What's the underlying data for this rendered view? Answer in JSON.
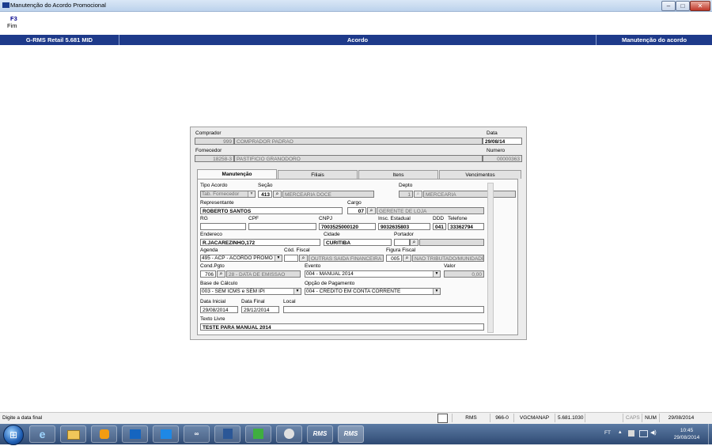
{
  "window": {
    "title": "Manutenção do Acordo Promocional",
    "minimize": "–",
    "maximize": "□",
    "close": "✕"
  },
  "menu": {
    "key": "F3",
    "label": "Fim"
  },
  "header": {
    "app": "G-RMS Retail 5.681 MID",
    "center": "Acordo",
    "right": "Manutenção do acordo"
  },
  "form": {
    "comprador": {
      "label": "Comprador",
      "code": "999",
      "name": "COMPRADOR PADRAO"
    },
    "data": {
      "label": "Data",
      "value": "29/08/14"
    },
    "fornecedor": {
      "label": "Fornecedor",
      "code": "18258-3",
      "name": "PASTIFICIO GRANODORO"
    },
    "numero": {
      "label": "Numero",
      "value": "00000363"
    },
    "tabs": [
      "Manutenção",
      "Filiais",
      "Itens",
      "Vencimentos"
    ],
    "tipo_acordo": {
      "label": "Tipo Acordo",
      "value": "Tab. Fornecedor"
    },
    "secao": {
      "label": "Seção",
      "code": "413",
      "name": "MERCEARIA DOCE"
    },
    "depto": {
      "label": "Depto",
      "code": "1",
      "name": "MERCEARIA"
    },
    "representante": {
      "label": "Representante",
      "value": "ROBERTO SANTOS"
    },
    "cargo": {
      "label": "Cargo",
      "code": "07",
      "name": "GERENTE DE LOJA"
    },
    "rg": {
      "label": "RG",
      "value": ""
    },
    "cpf": {
      "label": "CPF",
      "value": ""
    },
    "cnpj": {
      "label": "CNPJ",
      "value": "7003525000120"
    },
    "insc": {
      "label": "Insc. Estadual",
      "value": "9032635803"
    },
    "ddd": {
      "label": "DDD",
      "value": "041"
    },
    "telefone": {
      "label": "Telefone",
      "value": "33362794"
    },
    "endereco": {
      "label": "Endereco",
      "value": "R.JACAREZINHO,172"
    },
    "cidade": {
      "label": "Cidade",
      "value": "CURITIBA"
    },
    "portador": {
      "label": "Portador",
      "value": ""
    },
    "agenda": {
      "label": "Agenda",
      "value": "495 - ACP - ACORDO PROMO"
    },
    "cod_fiscal": {
      "label": "Cód. Fiscal",
      "code": "",
      "name": "OUTRAS SAIDA FINANCEIRA"
    },
    "figura_fiscal": {
      "label": "Figura Fiscal",
      "code": "005",
      "name": "NAO TRIBUTADO/MUNIDADE"
    },
    "cond_pgto": {
      "label": "Cond.Pgto",
      "code": "706",
      "name": "28 - DATA DE EMISSAO"
    },
    "evento": {
      "label": "Evento",
      "value": "004 - MANUAL 2014"
    },
    "valor": {
      "label": "Valor",
      "value": "0,00"
    },
    "base_calculo": {
      "label": "Base de Cálculo",
      "value": "003 - SEM ICMS e SEM IPI"
    },
    "opcao_pagamento": {
      "label": "Opção de Pagamento",
      "value": "004 - CRÉDITO EM CONTA CORRENTE"
    },
    "data_inicial": {
      "label": "Data Inicial",
      "value": "29/08/2014"
    },
    "data_final": {
      "label": "Data Final",
      "value": "29/12/2014"
    },
    "local": {
      "label": "Local",
      "value": ""
    },
    "texto_livre": {
      "label": "Texto Livre",
      "value": "TESTE PARA MANUAL 2014"
    }
  },
  "status": {
    "message": "Digite a data final",
    "c1": "RMS",
    "c2": "966-0",
    "c3": "VGCMANAP",
    "c4": "5.681.1030",
    "c5": "",
    "c6": "CAPS",
    "c7": "NUM",
    "c8": "29/08/2014"
  },
  "taskbar": {
    "rms1": "RMS",
    "rms2": "RMS",
    "lang": "FT",
    "time": "10:45",
    "date": "29/08/2014"
  },
  "colors": {
    "header_blue": "#1e3a8a",
    "readonly_gray": "#dcdcdc",
    "form_bg": "#ececec"
  }
}
